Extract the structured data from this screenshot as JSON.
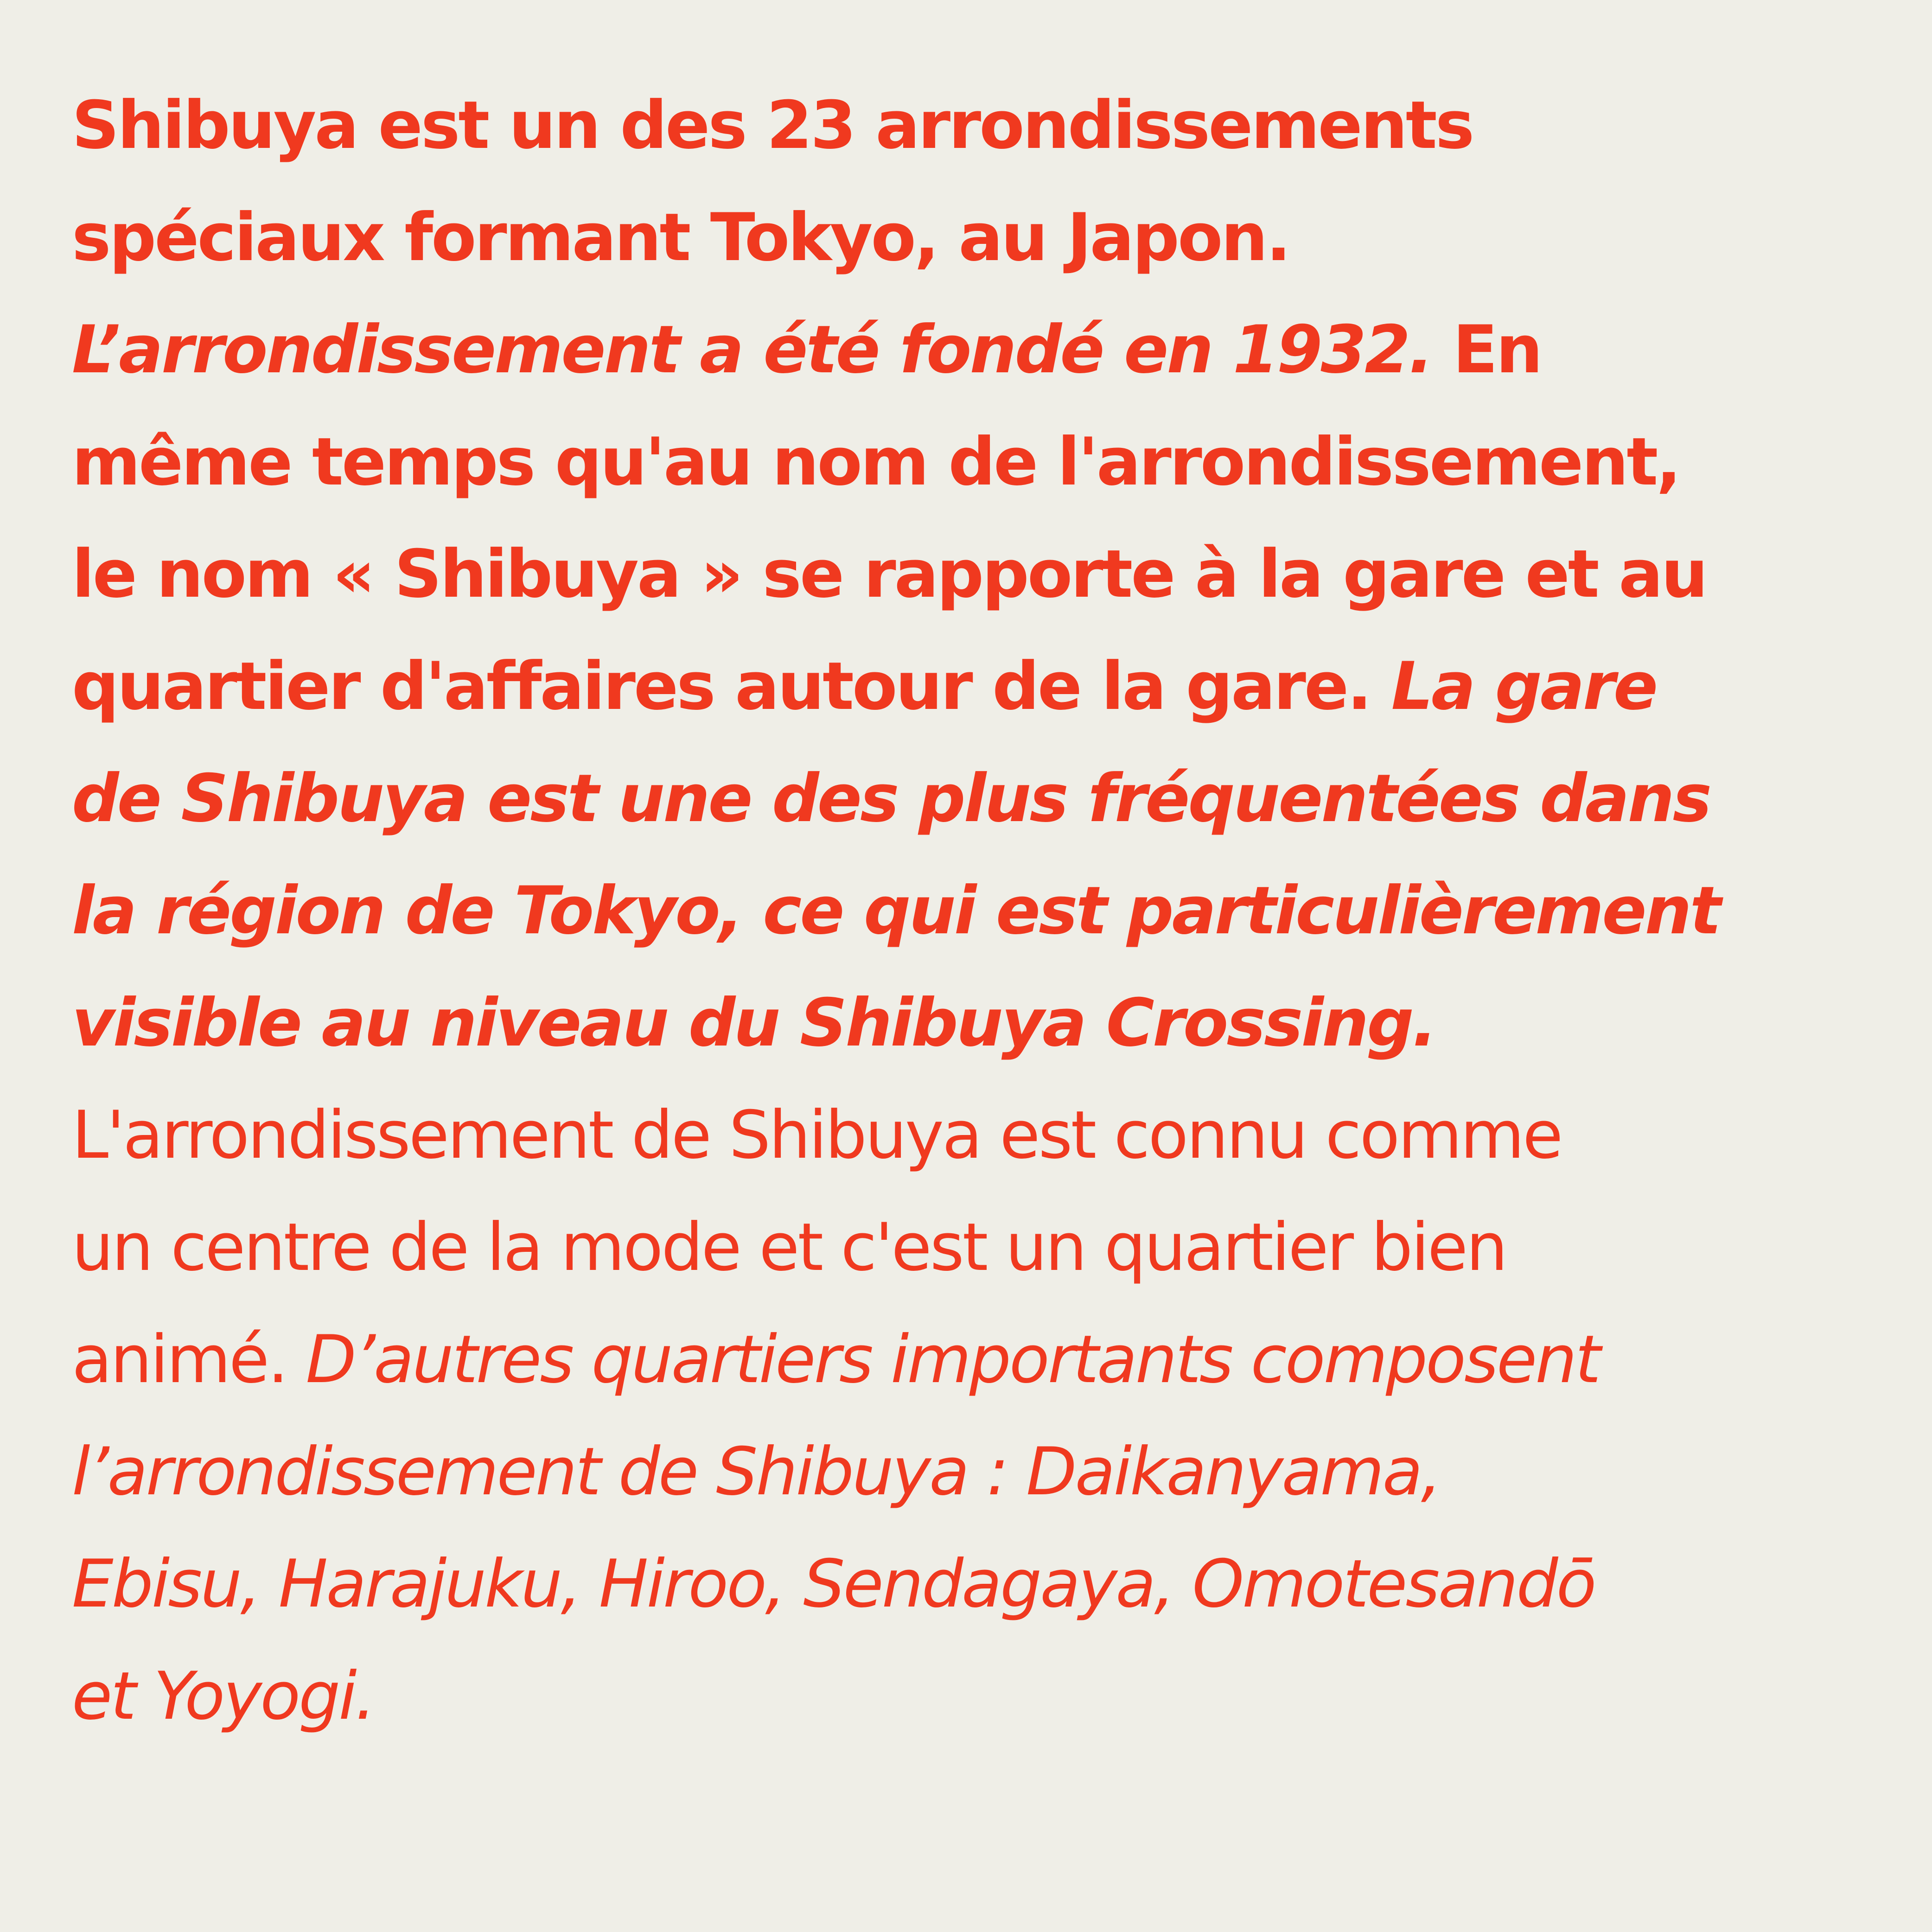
{
  "colors": {
    "background": "#efeee7",
    "text": "#f0391f"
  },
  "text_block": {
    "lines": [
      [
        {
          "style": "bold",
          "text": "Shibuya est un des 23 arrondissements"
        }
      ],
      [
        {
          "style": "bold",
          "text": "spéciaux formant Tokyo, au Japon."
        }
      ],
      [
        {
          "style": "bold-italic",
          "text": "L’arrondissement a été fondé en 1932. "
        },
        {
          "style": "bold",
          "text": "En"
        }
      ],
      [
        {
          "style": "bold",
          "text": "même temps qu'au nom de l'arrondissement,"
        }
      ],
      [
        {
          "style": "bold",
          "text": "le nom « Shibuya » se rapporte à la gare et au"
        }
      ],
      [
        {
          "style": "bold",
          "text": "quartier d'affaires autour de la gare. "
        },
        {
          "style": "bold-italic",
          "text": "La gare"
        }
      ],
      [
        {
          "style": "bold-italic",
          "text": "de Shibuya est une des plus fréquentées dans"
        }
      ],
      [
        {
          "style": "bold-italic",
          "text": "la région de Tokyo, ce qui est particulièrement"
        }
      ],
      [
        {
          "style": "bold-italic",
          "text": "visible au niveau du Shibuya Crossing."
        }
      ],
      [
        {
          "style": "regular",
          "text": "L'arrondissement de Shibuya est connu comme"
        }
      ],
      [
        {
          "style": "regular",
          "text": "un centre de la mode et c'est un quartier bien"
        }
      ],
      [
        {
          "style": "regular",
          "text": "animé. "
        },
        {
          "style": "italic",
          "text": "D’autres quartiers importants composent"
        }
      ],
      [
        {
          "style": "italic",
          "text": "l’arrondissement de Shibuya : Daikanyama,"
        }
      ],
      [
        {
          "style": "italic",
          "text": "Ebisu, Harajuku, Hiroo, Sendagaya, Omotesandō"
        }
      ],
      [
        {
          "style": "italic",
          "text": "et Yoyogi."
        }
      ]
    ]
  }
}
